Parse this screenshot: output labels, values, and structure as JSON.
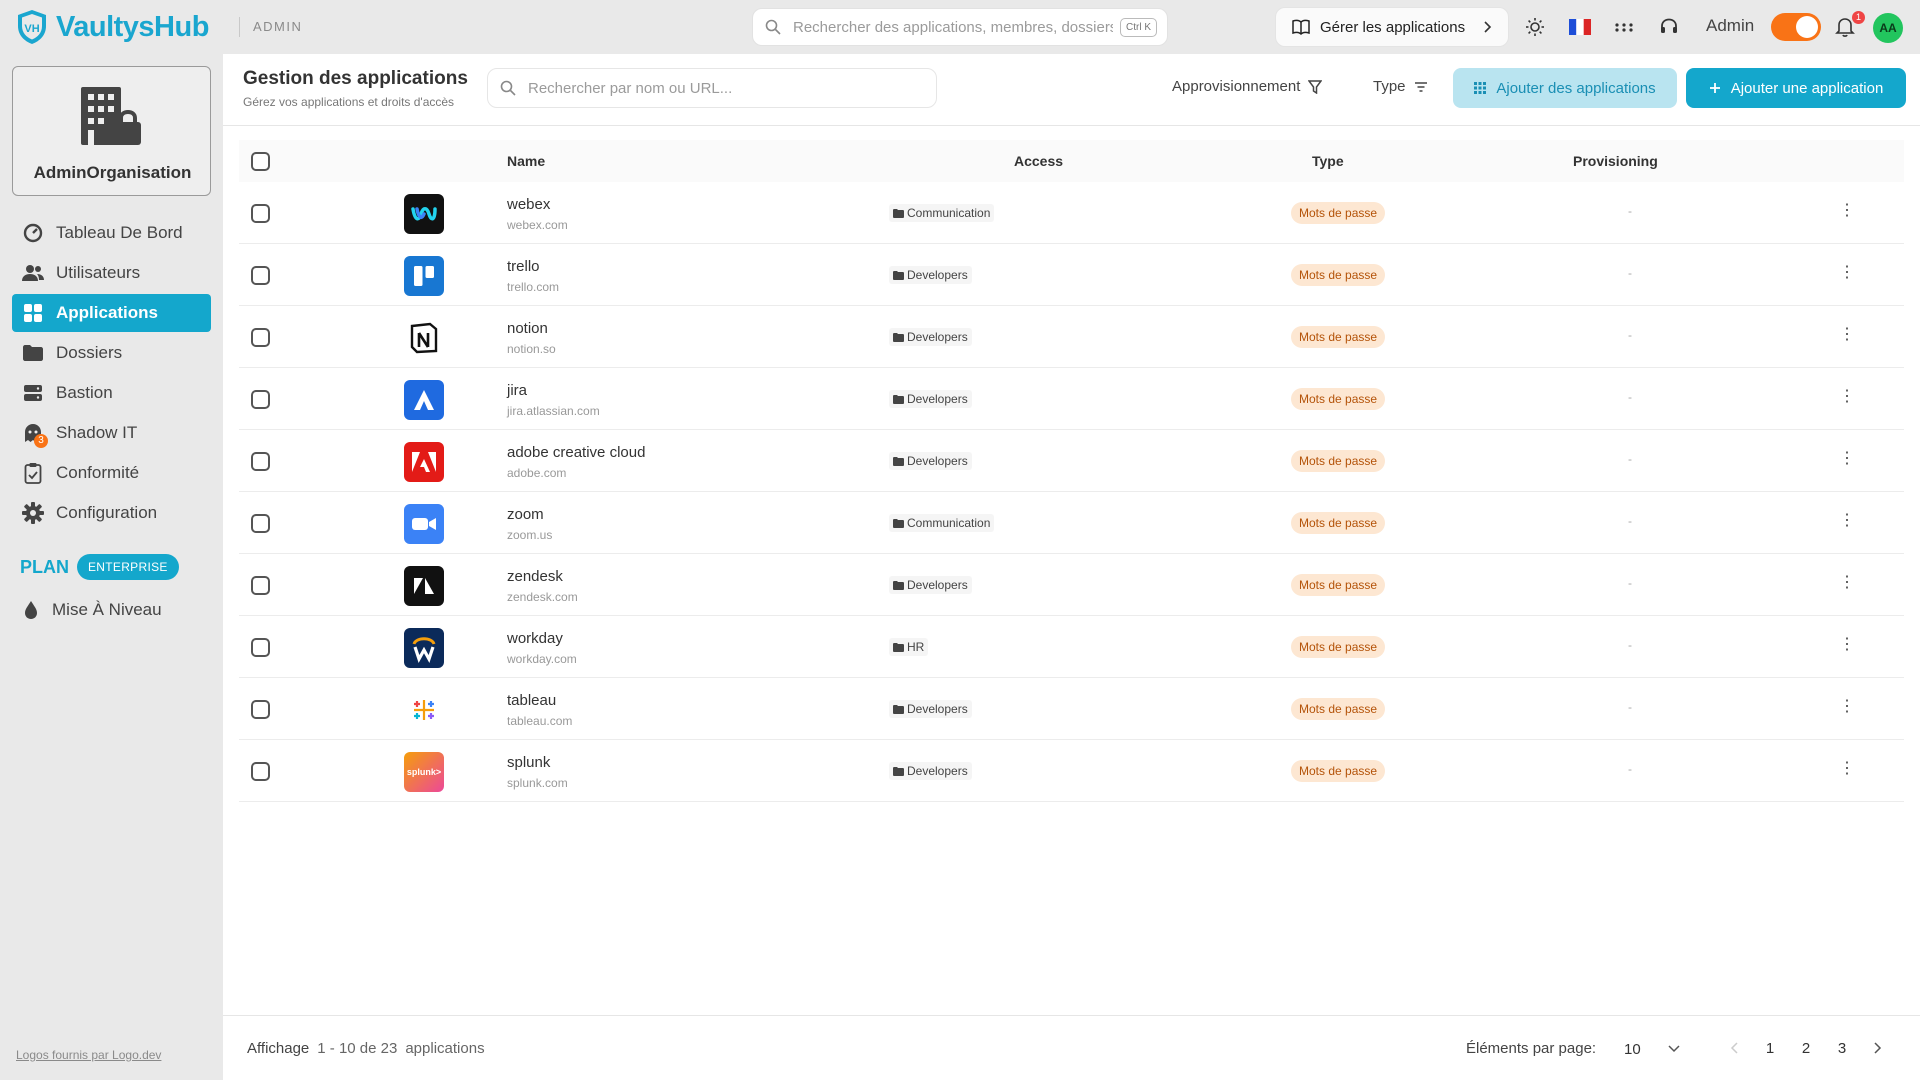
{
  "brand": {
    "name": "VaultysHub",
    "section": "ADMIN",
    "logo_mark": "VH"
  },
  "topbar": {
    "search_placeholder": "Rechercher des applications, membres, dossiers...",
    "shortcut": "Ctrl K",
    "manage_label": "Gérer les applications",
    "user_label": "Admin",
    "notification_count": "1",
    "avatar_initials": "AA",
    "flag": "🇫🇷",
    "theme_toggle_on": true
  },
  "sidebar": {
    "org_name": "AdminOrganisation",
    "items": [
      {
        "label": "Tableau De Bord",
        "icon": "dashboard-gauge-icon",
        "active": false
      },
      {
        "label": "Utilisateurs",
        "icon": "users-icon",
        "active": false
      },
      {
        "label": "Applications",
        "icon": "grid-icon",
        "active": true
      },
      {
        "label": "Dossiers",
        "icon": "folder-icon",
        "active": false
      },
      {
        "label": "Bastion",
        "icon": "server-icon",
        "active": false
      },
      {
        "label": "Shadow IT",
        "icon": "ghost-icon",
        "active": false,
        "badge": "3"
      },
      {
        "label": "Conformité",
        "icon": "clipboard-check-icon",
        "active": false
      },
      {
        "label": "Configuration",
        "icon": "gear-icon",
        "active": false
      }
    ],
    "plan_label": "PLAN",
    "plan_badge": "ENTERPRISE",
    "upgrade_label": "Mise À Niveau",
    "credit": "Logos fournis par Logo.dev"
  },
  "header": {
    "title": "Gestion des applications",
    "subtitle": "Gérez vos applications et droits d'accès",
    "search_placeholder": "Rechercher par nom ou URL...",
    "filter_provisioning": "Approvisionnement",
    "filter_type": "Type",
    "add_apps_label": "Ajouter des applications",
    "add_app_label": "Ajouter une application"
  },
  "table": {
    "columns": {
      "name": "Name",
      "access": "Access",
      "type": "Type",
      "provisioning": "Provisioning"
    },
    "rows": [
      {
        "name": "webex",
        "url": "webex.com",
        "access": "Communication",
        "type": "Mots de passe",
        "provisioning": "-",
        "logo": "webex-logo",
        "logo_bg": "#111111"
      },
      {
        "name": "trello",
        "url": "trello.com",
        "access": "Developers",
        "type": "Mots de passe",
        "provisioning": "-",
        "logo": "trello-logo",
        "logo_bg": "#1877d2"
      },
      {
        "name": "notion",
        "url": "notion.so",
        "access": "Developers",
        "type": "Mots de passe",
        "provisioning": "-",
        "logo": "notion-logo",
        "logo_bg": "#ffffff"
      },
      {
        "name": "jira",
        "url": "jira.atlassian.com",
        "access": "Developers",
        "type": "Mots de passe",
        "provisioning": "-",
        "logo": "jira-logo",
        "logo_bg": "#1f6ae0"
      },
      {
        "name": "adobe creative cloud",
        "url": "adobe.com",
        "access": "Developers",
        "type": "Mots de passe",
        "provisioning": "-",
        "logo": "adobe-logo",
        "logo_bg": "#e31b17"
      },
      {
        "name": "zoom",
        "url": "zoom.us",
        "access": "Communication",
        "type": "Mots de passe",
        "provisioning": "-",
        "logo": "zoom-logo",
        "logo_bg": "#3b82f6"
      },
      {
        "name": "zendesk",
        "url": "zendesk.com",
        "access": "Developers",
        "type": "Mots de passe",
        "provisioning": "-",
        "logo": "zendesk-logo",
        "logo_bg": "#111111"
      },
      {
        "name": "workday",
        "url": "workday.com",
        "access": "HR",
        "type": "Mots de passe",
        "provisioning": "-",
        "logo": "workday-logo",
        "logo_bg": "#0b2a5a"
      },
      {
        "name": "tableau",
        "url": "tableau.com",
        "access": "Developers",
        "type": "Mots de passe",
        "provisioning": "-",
        "logo": "tableau-logo",
        "logo_bg": "#ffffff"
      },
      {
        "name": "splunk",
        "url": "splunk.com",
        "access": "Developers",
        "type": "Mots de passe",
        "provisioning": "-",
        "logo": "splunk-logo",
        "logo_bg": "#e8388a",
        "logo_text": "splunk>"
      }
    ]
  },
  "footer": {
    "display_label": "Affichage",
    "range": "1 - 10 de 23",
    "unit": "applications",
    "per_page_label": "Éléments par page:",
    "per_page_value": "10",
    "pages": [
      "1",
      "2",
      "3"
    ]
  },
  "colors": {
    "accent": "#14a7cc",
    "orange": "#f97316",
    "pill_bg": "#fde7d2",
    "pill_text": "#b45309"
  }
}
